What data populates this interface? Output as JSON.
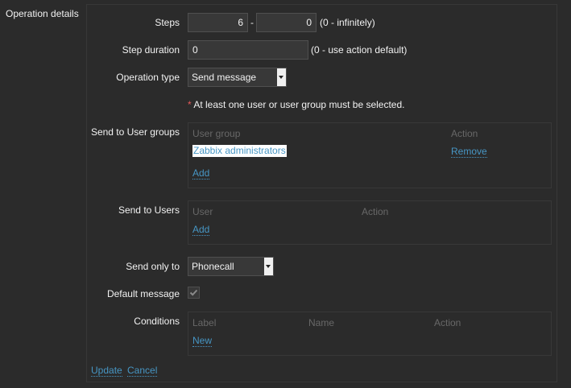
{
  "section_label": "Operation details",
  "steps": {
    "label": "Steps",
    "from": "6",
    "separator": "-",
    "to": "0",
    "hint": "(0 - infinitely)"
  },
  "step_duration": {
    "label": "Step duration",
    "value": "0",
    "hint": "(0 - use action default)"
  },
  "operation_type": {
    "label": "Operation type",
    "value": "Send message"
  },
  "warning": {
    "asterisk": "*",
    "text": "At least one user or user group must be selected."
  },
  "user_groups": {
    "label": "Send to User groups",
    "col_group": "User group",
    "col_action": "Action",
    "rows": [
      {
        "name": "Zabbix administrators",
        "action": "Remove"
      }
    ],
    "add": "Add"
  },
  "users": {
    "label": "Send to Users",
    "col_user": "User",
    "col_action": "Action",
    "add": "Add"
  },
  "send_only_to": {
    "label": "Send only to",
    "value": "Phonecall"
  },
  "default_message": {
    "label": "Default message",
    "checked": true
  },
  "conditions": {
    "label": "Conditions",
    "col_label": "Label",
    "col_name": "Name",
    "col_action": "Action",
    "new": "New"
  },
  "buttons": {
    "update": "Update",
    "cancel": "Cancel"
  }
}
